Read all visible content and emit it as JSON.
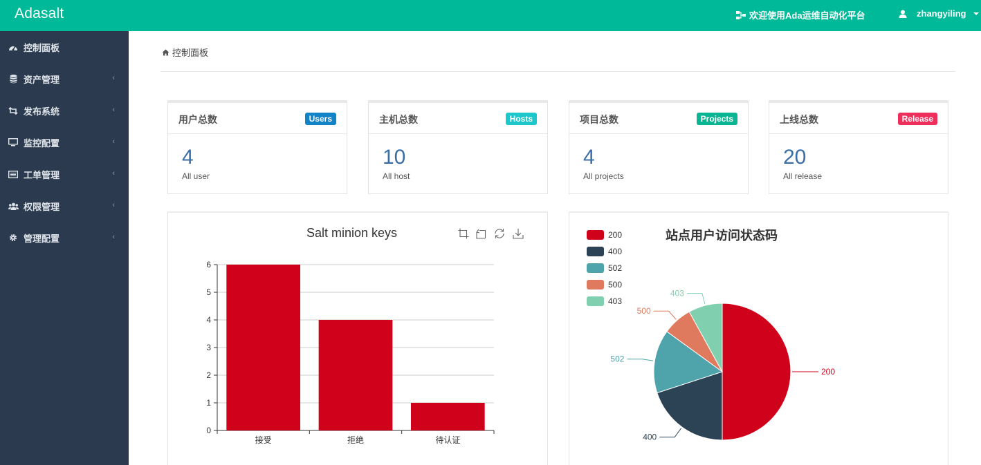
{
  "app": {
    "brand": "Adasalt",
    "welcome": "欢迎使用Ada运维自动化平台",
    "username": "zhangyiling"
  },
  "sidebar": {
    "items": [
      {
        "label": "控制面板",
        "icon": "dashboard-icon",
        "has_children": false
      },
      {
        "label": "资产管理",
        "icon": "database-icon",
        "has_children": true
      },
      {
        "label": "发布系统",
        "icon": "retweet-icon",
        "has_children": true
      },
      {
        "label": "监控配置",
        "icon": "monitor-icon",
        "has_children": true
      },
      {
        "label": "工单管理",
        "icon": "list-icon",
        "has_children": true
      },
      {
        "label": "权限管理",
        "icon": "users-icon",
        "has_children": true
      },
      {
        "label": "管理配置",
        "icon": "gear-icon",
        "has_children": true
      }
    ]
  },
  "breadcrumb": {
    "label": "控制面板",
    "icon": "home-icon"
  },
  "stats": [
    {
      "title": "用户总数",
      "badge": "Users",
      "badge_color": "#1183c6",
      "value": "4",
      "sub": "All user"
    },
    {
      "title": "主机总数",
      "badge": "Hosts",
      "badge_color": "#1dc8cd",
      "value": "10",
      "sub": "All host"
    },
    {
      "title": "项目总数",
      "badge": "Projects",
      "badge_color": "#0ab593",
      "value": "4",
      "sub": "All projects"
    },
    {
      "title": "上线总数",
      "badge": "Release",
      "badge_color": "#ee2f5c",
      "value": "20",
      "sub": "All release"
    }
  ],
  "bar_chart": {
    "toolbox": [
      "zoom-icon",
      "zoom-reset-icon",
      "refresh-icon",
      "download-icon"
    ],
    "chart_data": {
      "type": "bar",
      "title": "Salt minion keys",
      "categories": [
        "接受",
        "拒绝",
        "待认证"
      ],
      "values": [
        6,
        4,
        1
      ],
      "ylim": [
        0,
        6
      ],
      "yticks": [
        "0",
        "1",
        "2",
        "3",
        "4",
        "5",
        "6"
      ],
      "grid": true,
      "color": "#d0021b"
    }
  },
  "pie_chart": {
    "chart_data": {
      "type": "pie",
      "title": "站点用户访问状态码",
      "legend_position": "top-left",
      "slices": [
        {
          "label": "200",
          "value": 50,
          "color": "#d0021b"
        },
        {
          "label": "400",
          "value": 20,
          "color": "#2c4356"
        },
        {
          "label": "502",
          "value": 15,
          "color": "#4fa3ab"
        },
        {
          "label": "500",
          "value": 7,
          "color": "#e07a5f"
        },
        {
          "label": "403",
          "value": 8,
          "color": "#80cfae"
        }
      ]
    }
  }
}
